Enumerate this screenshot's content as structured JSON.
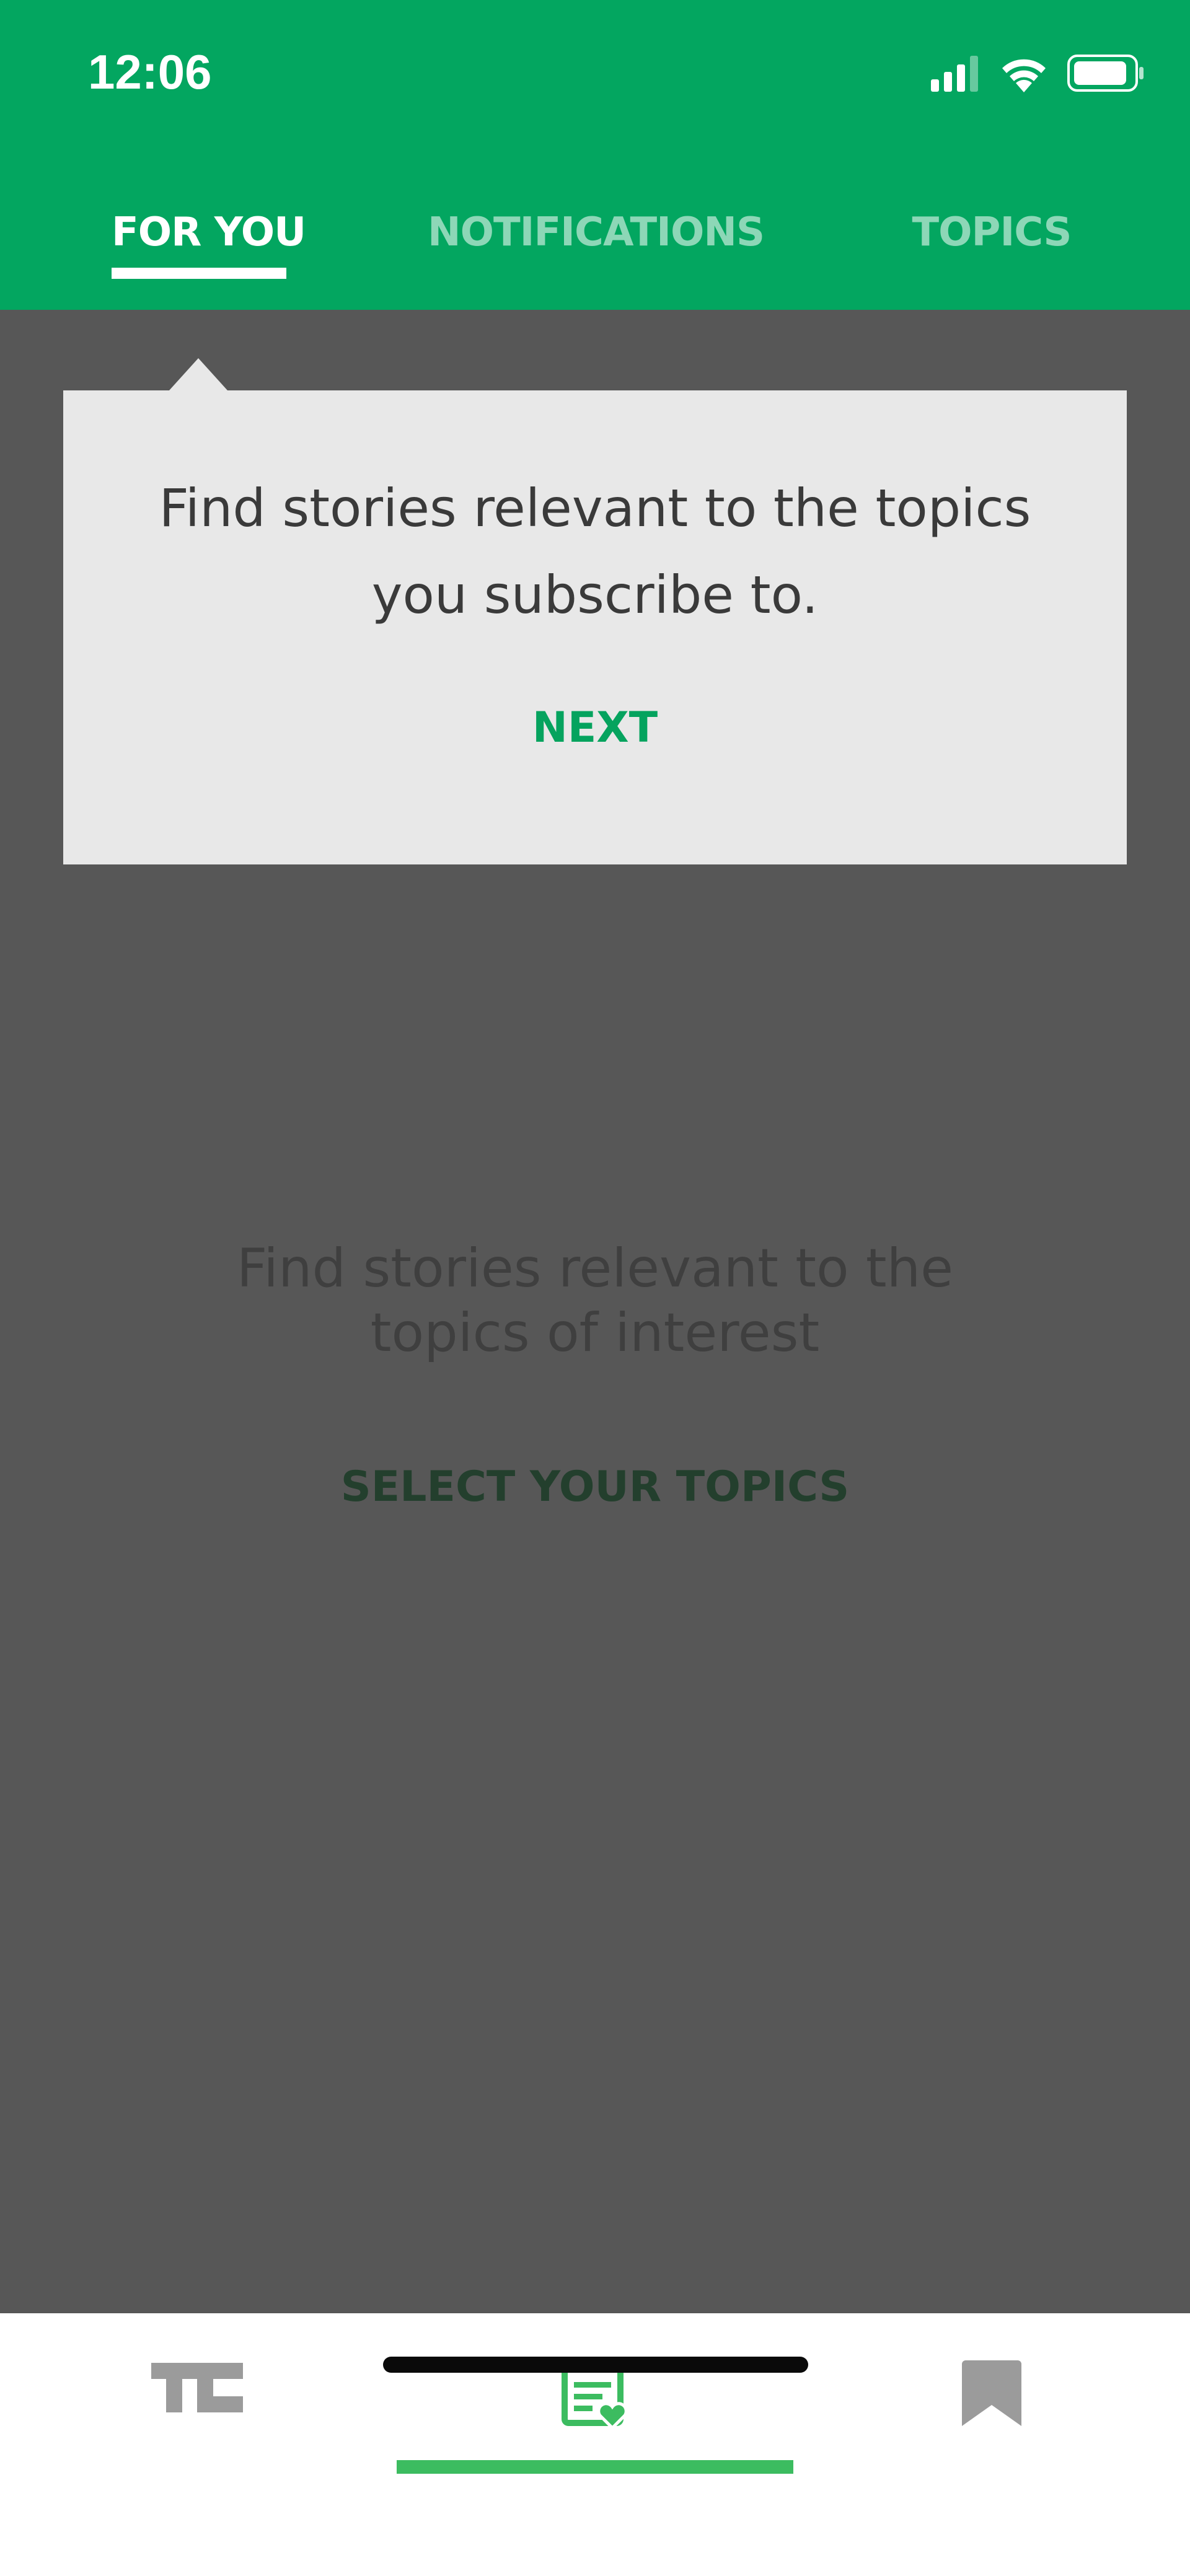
{
  "status_bar": {
    "time": "12:06",
    "icons": [
      "signal-icon",
      "wifi-icon",
      "battery-icon"
    ]
  },
  "tabs": [
    {
      "label": "FOR YOU",
      "active": true
    },
    {
      "label": "NOTIFICATIONS",
      "active": false
    },
    {
      "label": "TOPICS",
      "active": false
    }
  ],
  "tooltip": {
    "message": "Find stories relevant to the topics you subscribe to.",
    "next_label": "NEXT"
  },
  "empty_state": {
    "message": "Find stories relevant to the topics of interest",
    "action_label": "SELECT YOUR TOPICS"
  },
  "bottom_nav": {
    "items": [
      {
        "icon": "techcrunch-logo-icon",
        "active": false
      },
      {
        "icon": "personalized-feed-icon",
        "active": true
      },
      {
        "icon": "bookmark-icon",
        "active": false
      }
    ]
  },
  "colors": {
    "brand_green": "#03a660",
    "accent_green": "#3cbc60",
    "overlay_gray": "#575757",
    "tooltip_bg": "#e8e8e8"
  }
}
